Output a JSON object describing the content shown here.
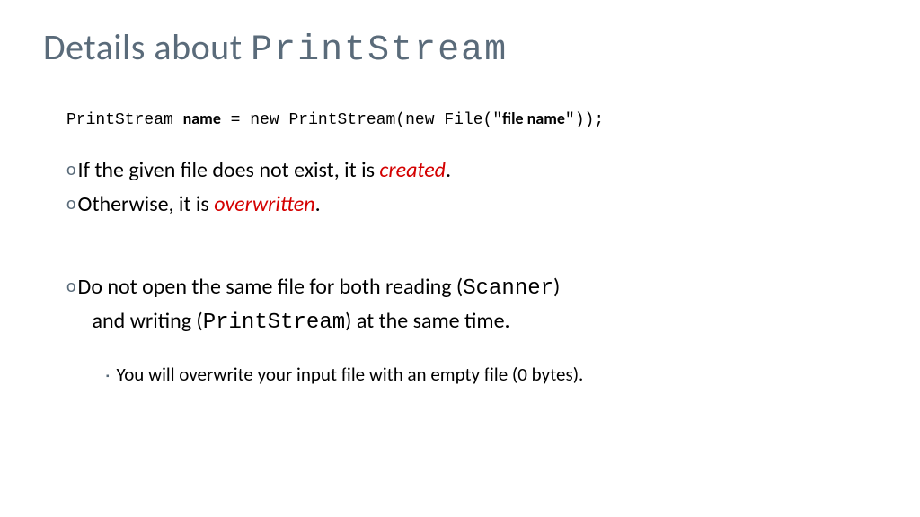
{
  "title": {
    "prefix": "Details about ",
    "mono": "PrintStream"
  },
  "code": {
    "p1": "PrintStream ",
    "name": "name",
    "p2": " = new PrintStream(new File(\"",
    "filename": "file name",
    "p3": "\"));"
  },
  "bullets": {
    "b1": {
      "marker": "o",
      "text_before": "If the given file does not exist, it is ",
      "highlight": "created",
      "text_after": "."
    },
    "b2": {
      "marker": "o",
      "text_before": "Otherwise, it is ",
      "highlight": "overwritten",
      "text_after": "."
    },
    "b3": {
      "marker": "o",
      "t1": "Do not open the same file for both reading (",
      "mono1": "Scanner",
      "t2": ")",
      "t3": "and writing (",
      "mono2": "PrintStream",
      "t4": ") at the same time."
    }
  },
  "sub": {
    "marker": "▪",
    "text": "You will overwrite your input file with an empty file (0 bytes)."
  }
}
